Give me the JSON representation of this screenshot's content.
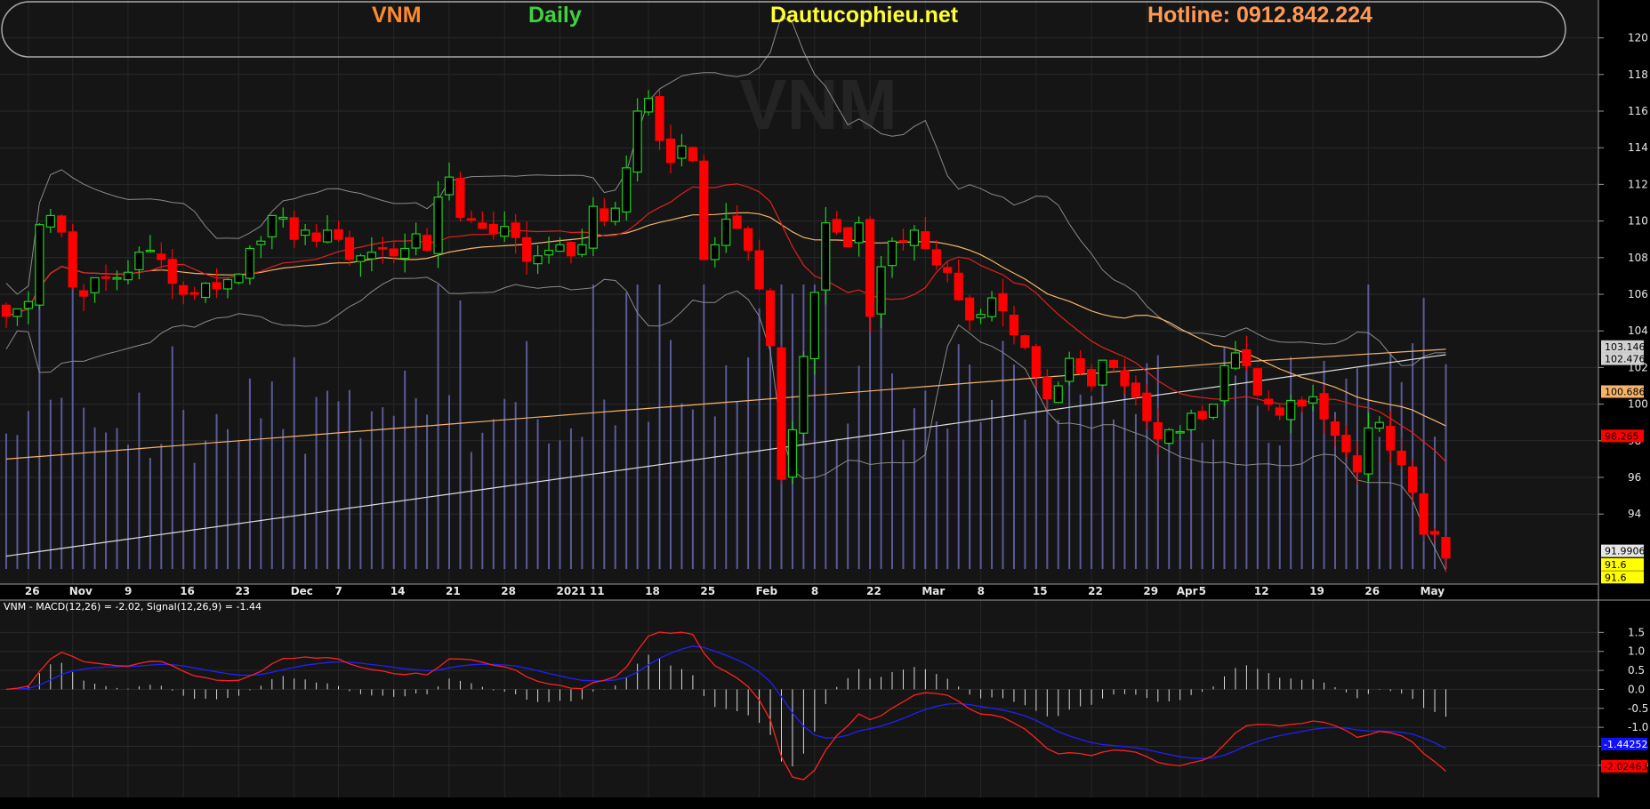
{
  "header": {
    "symbol": "VNM",
    "period": "Daily",
    "site": "Dautucophieu.net",
    "hotline": "Hotline: 0912.842.224",
    "watermark": "VNM"
  },
  "colors": {
    "background": "#000000",
    "panel": "#151515",
    "up": "#1fcf1f",
    "down": "#ff0000",
    "ma_short": "#e02020",
    "ma_mid": "#f5b36a",
    "ma_long": "#dcdcdc",
    "bands": "#8a8a8a",
    "volume": "#5a5a9a",
    "macd": "#ff2020",
    "signal": "#2020ff",
    "symbol_color": "#ff8a2a",
    "period_color": "#3fd23f",
    "site_color": "#ffff33",
    "hotline_color": "#ff9a55"
  },
  "chart_data": [
    {
      "type": "candlestick",
      "ylim": [
        91,
        121
      ],
      "yticks": [
        94,
        96,
        98,
        100,
        102,
        104,
        106,
        108,
        110,
        112,
        114,
        116,
        118,
        120
      ],
      "x_labels": [
        {
          "i": 2,
          "label": "26"
        },
        {
          "i": 6,
          "label": "Nov"
        },
        {
          "i": 11,
          "label": "9"
        },
        {
          "i": 16,
          "label": "16"
        },
        {
          "i": 21,
          "label": "23"
        },
        {
          "i": 26,
          "label": "Dec"
        },
        {
          "i": 30,
          "label": "7"
        },
        {
          "i": 35,
          "label": "14"
        },
        {
          "i": 40,
          "label": "21"
        },
        {
          "i": 45,
          "label": "28"
        },
        {
          "i": 50,
          "label": "2021"
        },
        {
          "i": 53,
          "label": "11"
        },
        {
          "i": 58,
          "label": "18"
        },
        {
          "i": 63,
          "label": "25"
        },
        {
          "i": 68,
          "label": "Feb"
        },
        {
          "i": 73,
          "label": "8"
        },
        {
          "i": 78,
          "label": "22"
        },
        {
          "i": 83,
          "label": "Mar"
        },
        {
          "i": 88,
          "label": "8"
        },
        {
          "i": 93,
          "label": "15"
        },
        {
          "i": 98,
          "label": "22"
        },
        {
          "i": 103,
          "label": "29"
        },
        {
          "i": 106,
          "label": "Apr"
        },
        {
          "i": 108,
          "label": "5"
        },
        {
          "i": 113,
          "label": "12"
        },
        {
          "i": 118,
          "label": "19"
        },
        {
          "i": 123,
          "label": "26"
        },
        {
          "i": 128,
          "label": "May"
        }
      ],
      "closes": [
        104.8,
        105.2,
        105.6,
        109.8,
        110.3,
        109.4,
        106.4,
        105.9,
        106.9,
        106.9,
        106.9,
        107.2,
        108.3,
        108.4,
        107.9,
        106.6,
        106.0,
        106.0,
        106.6,
        106.3,
        106.8,
        107.1,
        108.5,
        108.9,
        110.3,
        110.2,
        109.0,
        109.5,
        108.9,
        109.5,
        109.0,
        107.9,
        108.1,
        108.3,
        108.5,
        108.1,
        108.5,
        109.3,
        108.4,
        111.3,
        112.4,
        110.2,
        110.1,
        109.6,
        109.3,
        109.7,
        109.1,
        107.8,
        108.1,
        108.4,
        108.7,
        108.1,
        108.7,
        110.8,
        110.0,
        110.7,
        112.9,
        116.0,
        116.7,
        114.4,
        113.2,
        114.1,
        113.3,
        107.9,
        108.7,
        110.1,
        109.6,
        108.4,
        106.3,
        103.2,
        95.9,
        98.6,
        102.6,
        106.1,
        109.9,
        109.4,
        108.6,
        109.9,
        104.8,
        107.5,
        108.9,
        108.9,
        109.5,
        108.5,
        107.6,
        107.2,
        105.7,
        104.6,
        104.9,
        105.8,
        105.1,
        103.8,
        103.1,
        101.5,
        100.3,
        101.0,
        102.5,
        101.7,
        101.0,
        102.4,
        102.0,
        101.0,
        100.4,
        99.1,
        98.1,
        98.6,
        98.5,
        99.5,
        99.2,
        100.0,
        102.1,
        102.8,
        102.1,
        100.5,
        100.0,
        99.4,
        100.2,
        99.9,
        100.4,
        99.2,
        98.3,
        97.4,
        96.3,
        98.7,
        99.0,
        97.5,
        96.7,
        95.2,
        92.9,
        92.9,
        91.6
      ],
      "last_close": 91.6,
      "annotations": [
        "103.146",
        "102.476",
        "100.686",
        "98.265",
        "91.9906",
        "91.6",
        "91.6"
      ]
    },
    {
      "type": "line",
      "title": "VNM - MACD(12,26) = -2.02, Signal(12,26,9) = -1.44",
      "ylim": [
        -2.8,
        2.0
      ],
      "yticks": [
        1.5,
        1.0,
        0.5,
        0.0,
        -0.5,
        -1.0,
        -1.5,
        -2.0
      ],
      "annotations": [
        "-1.44252",
        "-2.02463"
      ]
    }
  ]
}
